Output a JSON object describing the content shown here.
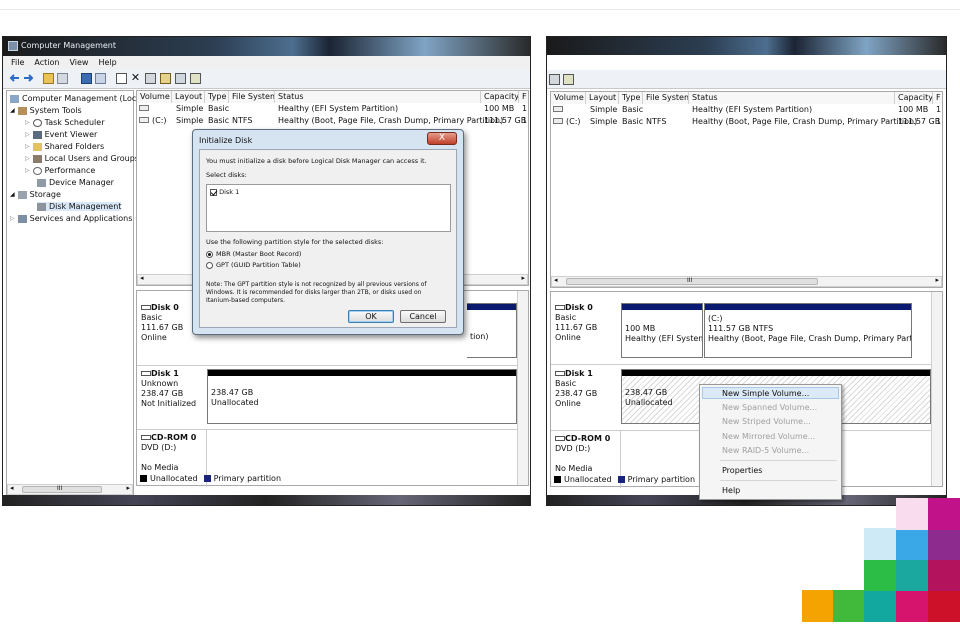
{
  "left_screenshot": {
    "title": "Computer Management",
    "menu": [
      "File",
      "Action",
      "View",
      "Help"
    ],
    "tree": [
      {
        "label": "Computer Management (Local",
        "icon": "computer-icon"
      },
      {
        "label": "System Tools",
        "icon": "tools-icon"
      },
      {
        "label": "Task Scheduler",
        "icon": "clock-icon"
      },
      {
        "label": "Event Viewer",
        "icon": "event-viewer-icon"
      },
      {
        "label": "Shared Folders",
        "icon": "folder-icon"
      },
      {
        "label": "Local Users and Groups",
        "icon": "users-icon"
      },
      {
        "label": "Performance",
        "icon": "performance-icon"
      },
      {
        "label": "Device Manager",
        "icon": "device-manager-icon"
      },
      {
        "label": "Storage",
        "icon": "storage-icon"
      },
      {
        "label": "Disk Management",
        "icon": "disk-icon"
      },
      {
        "label": "Services and Applications",
        "icon": "services-icon"
      }
    ],
    "columns": [
      "Volume",
      "Layout",
      "Type",
      "File System",
      "Status",
      "Capacity",
      "F"
    ],
    "rows": [
      {
        "volume": "",
        "layout": "Simple",
        "type": "Basic",
        "fs": "",
        "status": "Healthy (EFI System Partition)",
        "capacity": "100 MB",
        "f": "1"
      },
      {
        "volume": "(C:)",
        "layout": "Simple",
        "type": "Basic",
        "fs": "NTFS",
        "status": "Healthy (Boot, Page File, Crash Dump, Primary Partition)",
        "capacity": "111.57 GB",
        "f": "1"
      }
    ],
    "scroll_glyph": "III",
    "disks": {
      "disk0": {
        "name": "Disk 0",
        "type": "Basic",
        "size": "111.67 GB",
        "state": "Online",
        "partial_text": "tion)"
      },
      "disk1": {
        "name": "Disk 1",
        "type": "Unknown",
        "size": "238.47 GB",
        "state": "Not Initialized",
        "part_size": "238.47 GB",
        "part_state": "Unallocated"
      },
      "cdrom": {
        "name": "CD-ROM 0",
        "type": "DVD (D:)",
        "state": "No Media"
      }
    },
    "legend": [
      "Unallocated",
      "Primary partition"
    ],
    "dialog": {
      "title": "Initialize Disk",
      "close": "X",
      "intro": "You must initialize a disk before Logical Disk Manager can access it.",
      "select_label": "Select disks:",
      "disk_item": "Disk 1",
      "style_label": "Use the following partition style for the selected disks:",
      "mbr": "MBR (Master Boot Record)",
      "gpt": "GPT (GUID Partition Table)",
      "note1": "Note: The GPT partition style is not recognized by all previous versions of",
      "note2": "Windows. It is recommended for disks larger than 2TB, or disks used on",
      "note3": "Itanium-based computers.",
      "ok": "OK",
      "cancel": "Cancel"
    }
  },
  "right_screenshot": {
    "columns": [
      "Volume",
      "Layout",
      "Type",
      "File System",
      "Status",
      "Capacity",
      "F"
    ],
    "rows": [
      {
        "volume": "",
        "layout": "Simple",
        "type": "Basic",
        "fs": "",
        "status": "Healthy (EFI System Partition)",
        "capacity": "100 MB",
        "f": "1"
      },
      {
        "volume": "(C:)",
        "layout": "Simple",
        "type": "Basic",
        "fs": "NTFS",
        "status": "Healthy (Boot, Page File, Crash Dump, Primary Partition)",
        "capacity": "111.57 GB",
        "f": "1"
      }
    ],
    "scroll_glyph": "III",
    "disks": {
      "disk0": {
        "name": "Disk 0",
        "type": "Basic",
        "size": "111.67 GB",
        "state": "Online",
        "p1_size": "100 MB",
        "p1_status": "Healthy (EFI System I",
        "p2_name": "(C:)",
        "p2_size": "111.57 GB NTFS",
        "p2_status": "Healthy (Boot, Page File, Crash Dump, Primary Partition)"
      },
      "disk1": {
        "name": "Disk 1",
        "type": "Basic",
        "size": "238.47 GB",
        "state": "Online",
        "part_size": "238.47 GB",
        "part_state": "Unallocated"
      },
      "cdrom": {
        "name": "CD-ROM 0",
        "type": "DVD (D:)",
        "state": "No Media"
      }
    },
    "legend": [
      "Unallocated",
      "Primary partition"
    ],
    "context_menu": {
      "new_simple": "New Simple Volume...",
      "new_spanned": "New Spanned Volume...",
      "new_striped": "New Striped Volume...",
      "new_mirrored": "New Mirrored Volume...",
      "new_raid5": "New RAID-5 Volume...",
      "properties": "Properties",
      "help": "Help"
    }
  },
  "colors": {
    "unallocated": "#000000",
    "primary": "#1a237e",
    "accent_bar": "#0a1a6e"
  },
  "mosaic_colors": [
    "#f5a300",
    "#41b93a",
    "#12a8a0",
    "#d6146d",
    "#cc1128",
    "#2bbd45",
    "#1ba89f",
    "#8e2b8f",
    "#b3125d",
    "#cfeaf7",
    "#3aa7e6",
    "#7f2a8a",
    "#fadcef",
    "#f3c6e6",
    "#c2128a"
  ]
}
